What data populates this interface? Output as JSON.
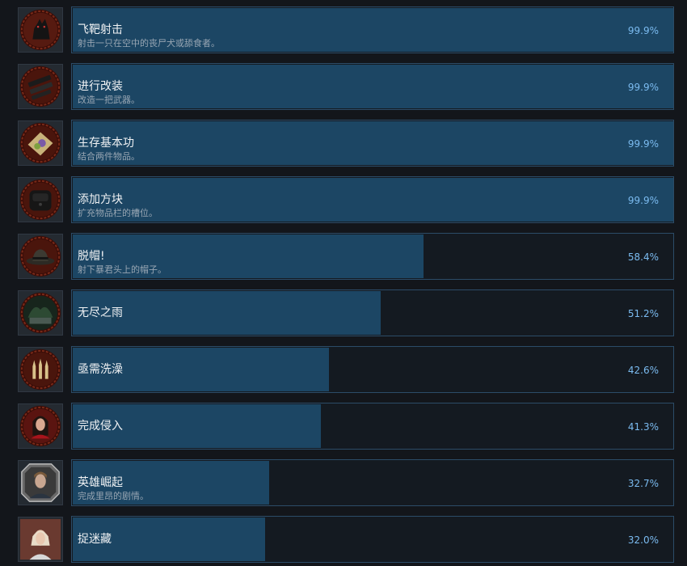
{
  "achievements": [
    {
      "title": "飞靶射击",
      "desc": "射击一只在空中的丧尸犬或舔食者。",
      "percent": 99.9,
      "percent_label": "99.9%",
      "icon": "dog-icon"
    },
    {
      "title": "进行改装",
      "desc": "改造一把武器。",
      "percent": 99.9,
      "percent_label": "99.9%",
      "icon": "weapon-parts-icon"
    },
    {
      "title": "生存基本功",
      "desc": "结合两件物品。",
      "percent": 99.9,
      "percent_label": "99.9%",
      "icon": "herb-icon"
    },
    {
      "title": "添加方块",
      "desc": "扩充物品栏的槽位。",
      "percent": 99.9,
      "percent_label": "99.9%",
      "icon": "hip-pouch-icon"
    },
    {
      "title": "脱帽!",
      "desc": "射下暴君头上的帽子。",
      "percent": 58.4,
      "percent_label": "58.4%",
      "icon": "hat-icon"
    },
    {
      "title": "无尽之雨",
      "desc": "",
      "percent": 51.2,
      "percent_label": "51.2%",
      "icon": "plant-monster-icon"
    },
    {
      "title": "亟需洗澡",
      "desc": "",
      "percent": 42.6,
      "percent_label": "42.6%",
      "icon": "chess-pieces-icon"
    },
    {
      "title": "完成侵入",
      "desc": "",
      "percent": 41.3,
      "percent_label": "41.3%",
      "icon": "ada-portrait-icon"
    },
    {
      "title": "英雄崛起",
      "desc": "完成里昂的剧情。",
      "percent": 32.7,
      "percent_label": "32.7%",
      "icon": "leon-portrait-icon"
    },
    {
      "title": "捉迷藏",
      "desc": "",
      "percent": 32.0,
      "percent_label": "32.0%",
      "icon": "sherry-portrait-icon"
    }
  ]
}
